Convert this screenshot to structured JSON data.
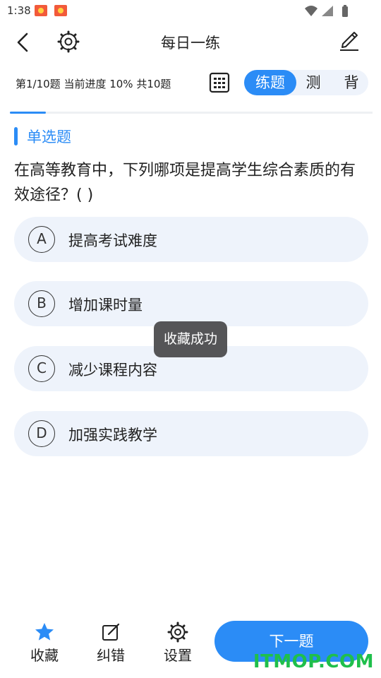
{
  "status_bar": {
    "time": "1:38",
    "icons": [
      "notification-game-icon",
      "notification-game-icon",
      "wifi-icon",
      "signal-icon",
      "battery-icon"
    ]
  },
  "header": {
    "title": "每日一练",
    "back_icon": "back-arrow-icon",
    "settings_icon": "gear-icon",
    "edit_icon": "pencil-icon"
  },
  "progress": {
    "text": "第1/10题 当前进度 10% 共10题",
    "current": 1,
    "total": 10,
    "percent": 10
  },
  "mode_toggle": {
    "options": [
      "练题",
      "测",
      "背"
    ],
    "active": "练题"
  },
  "question": {
    "type_label": "单选题",
    "text": "在高等教育中，下列哪项是提高学生综合素质的有效途径？( )",
    "options": [
      {
        "letter": "A",
        "text": "提高考试难度"
      },
      {
        "letter": "B",
        "text": "增加课时量"
      },
      {
        "letter": "C",
        "text": "减少课程内容"
      },
      {
        "letter": "D",
        "text": "加强实践教学"
      }
    ]
  },
  "toast": {
    "text": "收藏成功"
  },
  "bottom_bar": {
    "favorite_label": "收藏",
    "correct_error_label": "纠错",
    "settings_label": "设置",
    "next_label": "下一题"
  },
  "watermark": {
    "text": "ITMOP.COM"
  },
  "colors": {
    "accent": "#2b8cf6",
    "option_bg": "#eef3fb",
    "toast_bg": "#555557",
    "watermark": "#1fbf4b"
  }
}
